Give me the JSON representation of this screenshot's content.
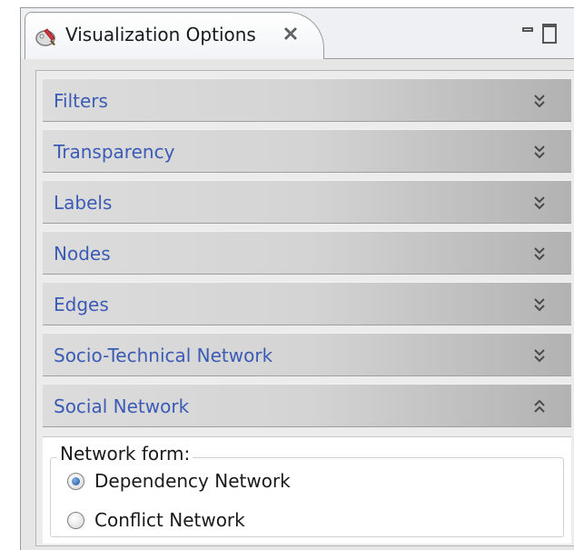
{
  "view": {
    "title": "Visualization Options",
    "icons": {
      "view": "palette-icon",
      "close": "close-icon",
      "minimize": "minimize-icon",
      "maximize": "maximize-icon"
    }
  },
  "sections": [
    {
      "label": "Filters",
      "state": "collapsed"
    },
    {
      "label": "Transparency",
      "state": "collapsed"
    },
    {
      "label": "Labels",
      "state": "collapsed"
    },
    {
      "label": "Nodes",
      "state": "collapsed"
    },
    {
      "label": "Edges",
      "state": "collapsed"
    },
    {
      "label": "Socio-Technical Network",
      "state": "collapsed"
    },
    {
      "label": "Social Network",
      "state": "expanded"
    }
  ],
  "social_network": {
    "group_title": "Network form:",
    "options": [
      {
        "label": "Dependency Network",
        "selected": true
      },
      {
        "label": "Conflict Network",
        "selected": false
      }
    ]
  },
  "colors": {
    "section_label": "#3b5bb5",
    "radio_selected": "#1f4f9a"
  }
}
